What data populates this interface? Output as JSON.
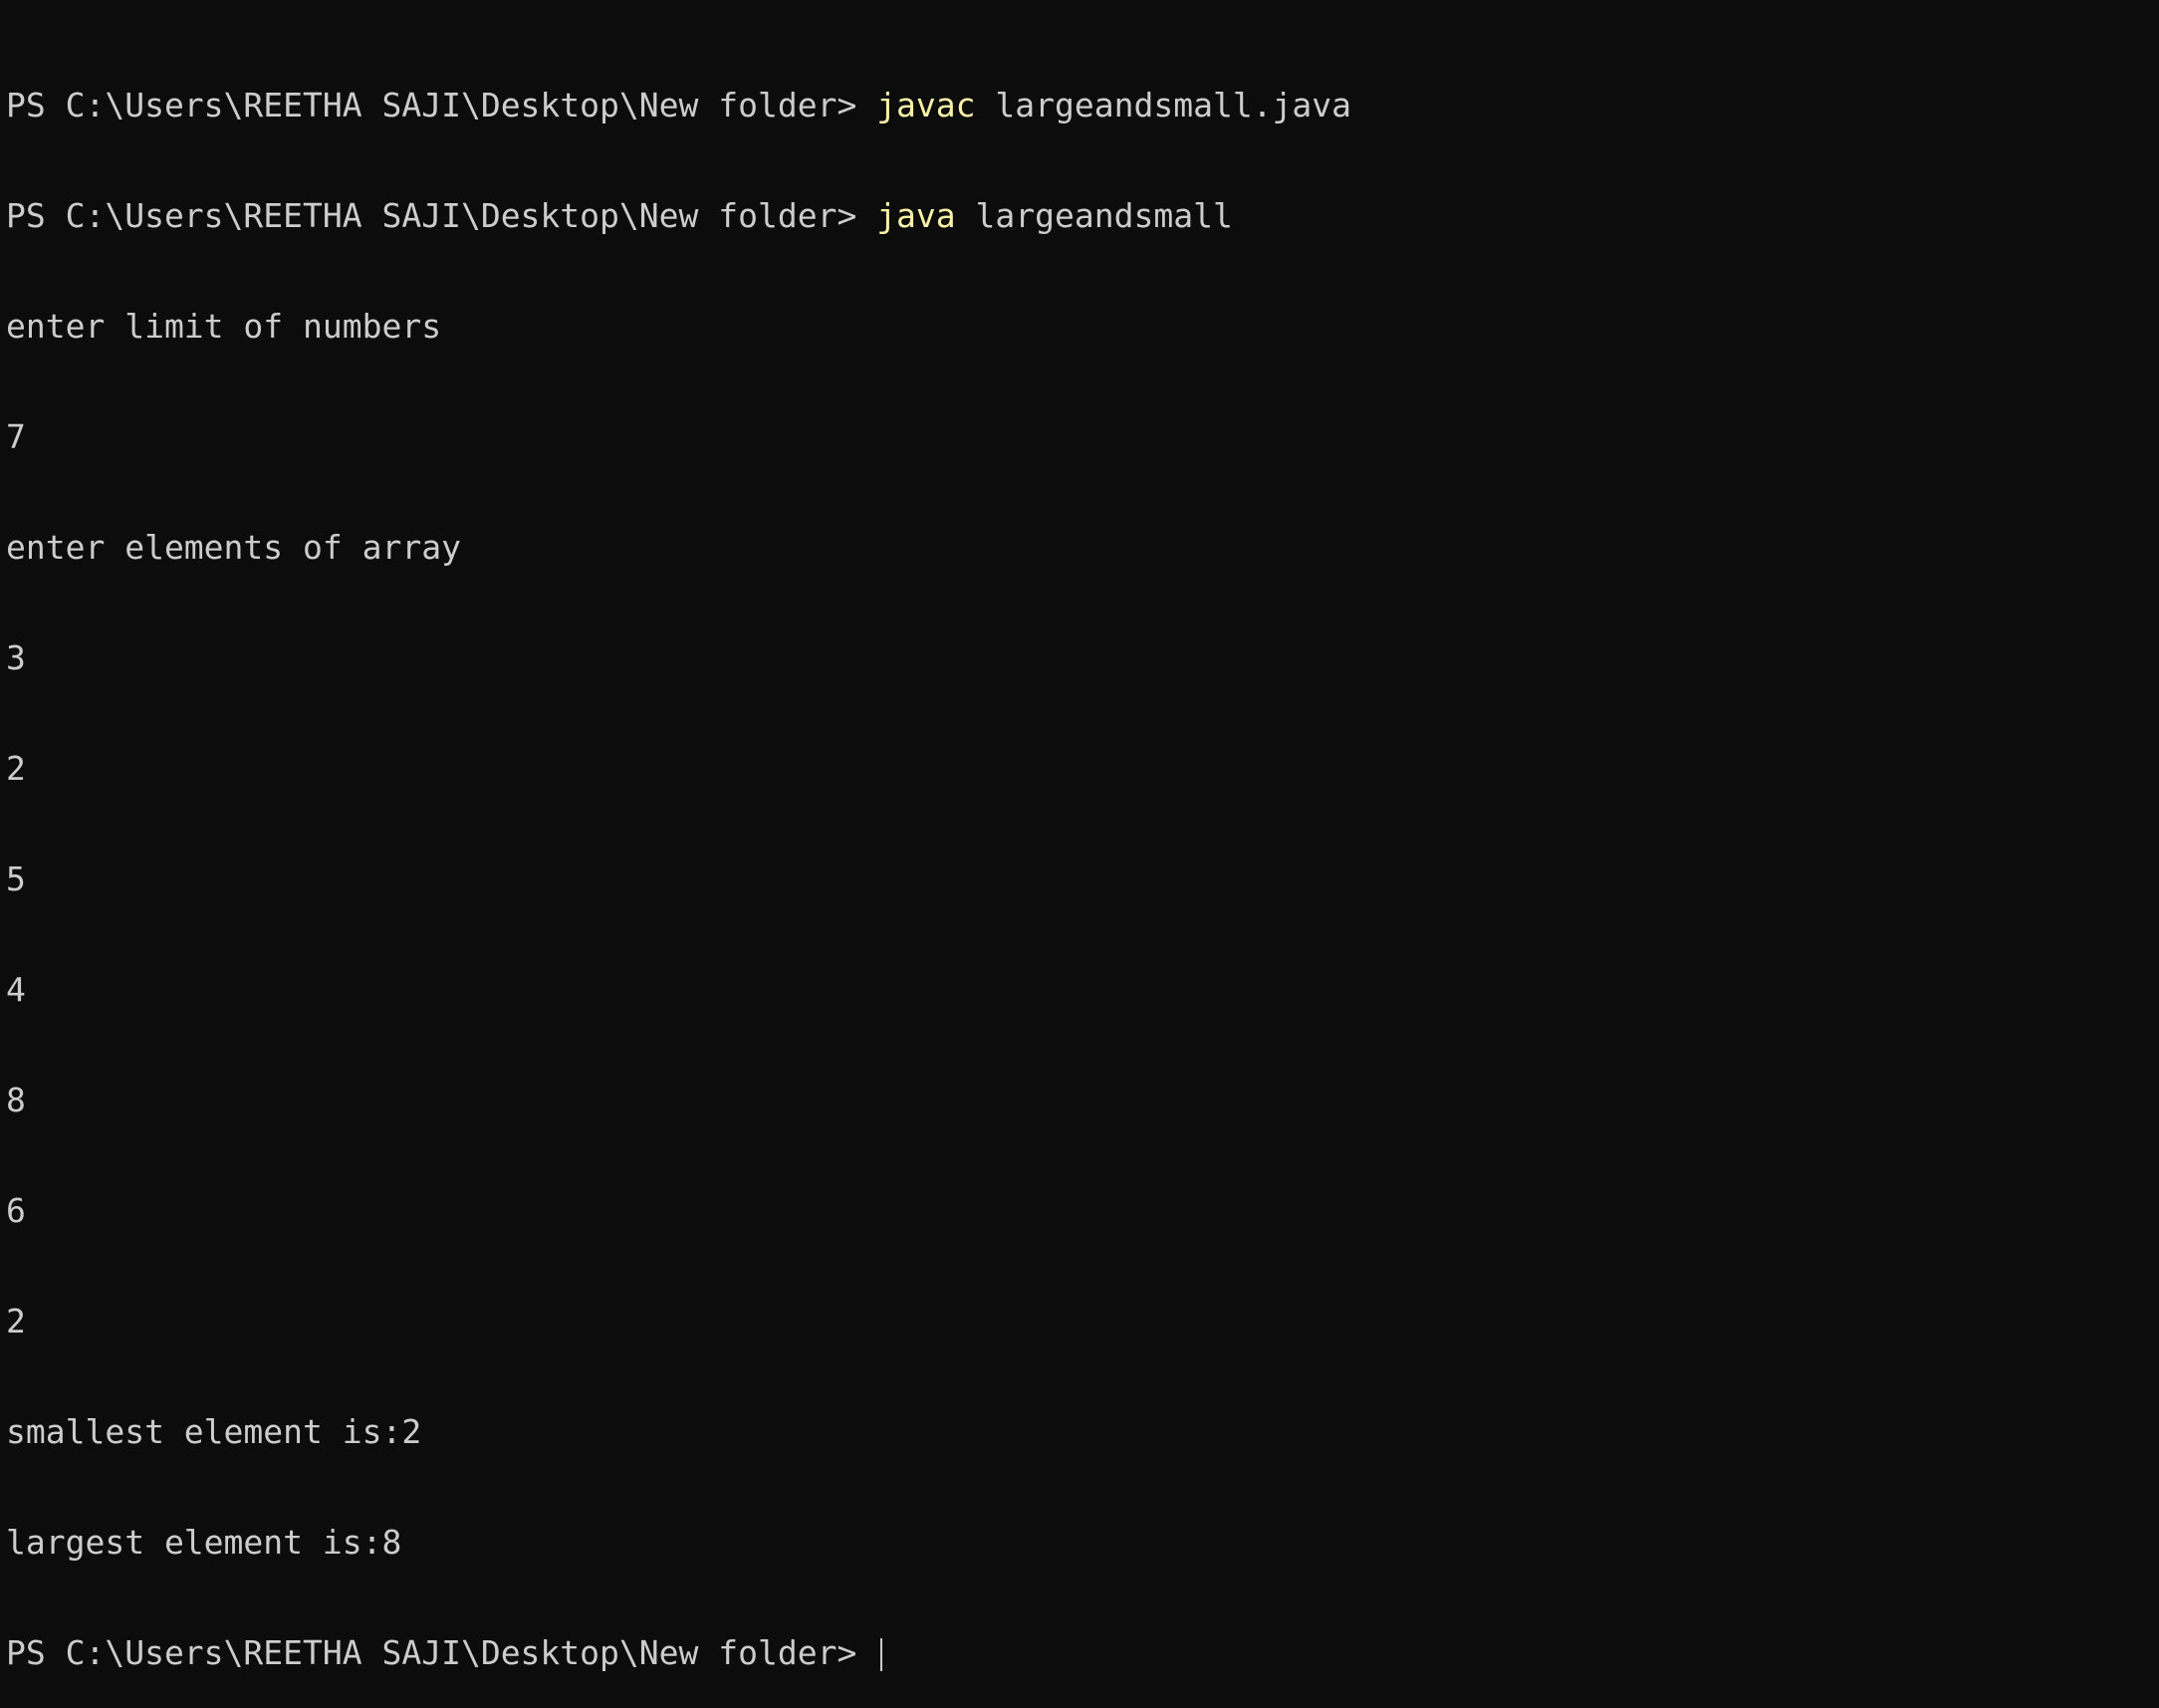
{
  "terminal": {
    "prompt": "PS C:\\Users\\REETHA SAJI\\Desktop\\New folder>",
    "lines": [
      {
        "type": "command",
        "cmd": "javac",
        "args": "largeandsmall.java"
      },
      {
        "type": "command",
        "cmd": "java",
        "args": "largeandsmall"
      },
      {
        "type": "output",
        "text": "enter limit of numbers"
      },
      {
        "type": "output",
        "text": "7"
      },
      {
        "type": "output",
        "text": "enter elements of array"
      },
      {
        "type": "output",
        "text": "3"
      },
      {
        "type": "output",
        "text": "2"
      },
      {
        "type": "output",
        "text": "5"
      },
      {
        "type": "output",
        "text": "4"
      },
      {
        "type": "output",
        "text": "8"
      },
      {
        "type": "output",
        "text": "6"
      },
      {
        "type": "output",
        "text": "2"
      },
      {
        "type": "output",
        "text": "smallest element is:2"
      },
      {
        "type": "output",
        "text": "largest element is:8"
      }
    ]
  },
  "colors": {
    "background": "#0c0c0c",
    "text": "#cccccc",
    "command": "#f9f1a5"
  }
}
